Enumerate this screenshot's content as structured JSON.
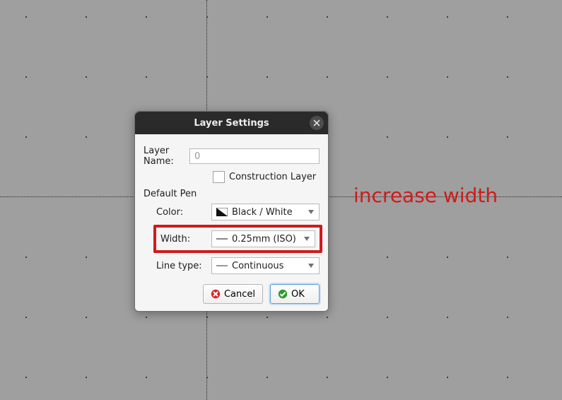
{
  "dialog": {
    "title": "Layer Settings",
    "layer_name_label": "Layer Name:",
    "layer_name_value": "0",
    "construction_label": "Construction Layer",
    "section_label": "Default Pen",
    "color_label": "Color:",
    "color_value": "Black / White",
    "width_label": "Width:",
    "width_value": "0.25mm (ISO)",
    "linetype_label": "Line type:",
    "linetype_value": "Continuous",
    "cancel_label": "Cancel",
    "ok_label": "OK"
  },
  "annotation": {
    "text": "increase width"
  }
}
